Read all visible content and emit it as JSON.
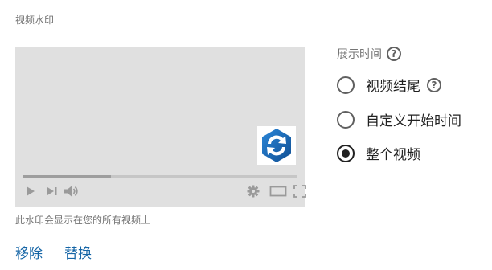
{
  "section_title": "视频水印",
  "preview": {
    "progress_fraction": 0.32,
    "watermark_logo": "blue-rotating-arrows-logo",
    "controls": {
      "left": [
        "play-icon",
        "skip-next-icon",
        "volume-icon"
      ],
      "right": [
        "gear-icon",
        "theater-mode-icon",
        "fullscreen-icon"
      ]
    }
  },
  "caption": "此水印会显示在您的所有视频上",
  "actions": {
    "remove_label": "移除",
    "replace_label": "替换"
  },
  "timing": {
    "title": "展示时间",
    "options": [
      {
        "label": "视频结尾",
        "has_help": true,
        "selected": false
      },
      {
        "label": "自定义开始时间",
        "has_help": false,
        "selected": false
      },
      {
        "label": "整个视频",
        "has_help": false,
        "selected": true
      }
    ]
  },
  "colors": {
    "link": "#1565a6",
    "preview_bg": "#e0e0e0",
    "logo_blue": "#1e6fb5"
  }
}
